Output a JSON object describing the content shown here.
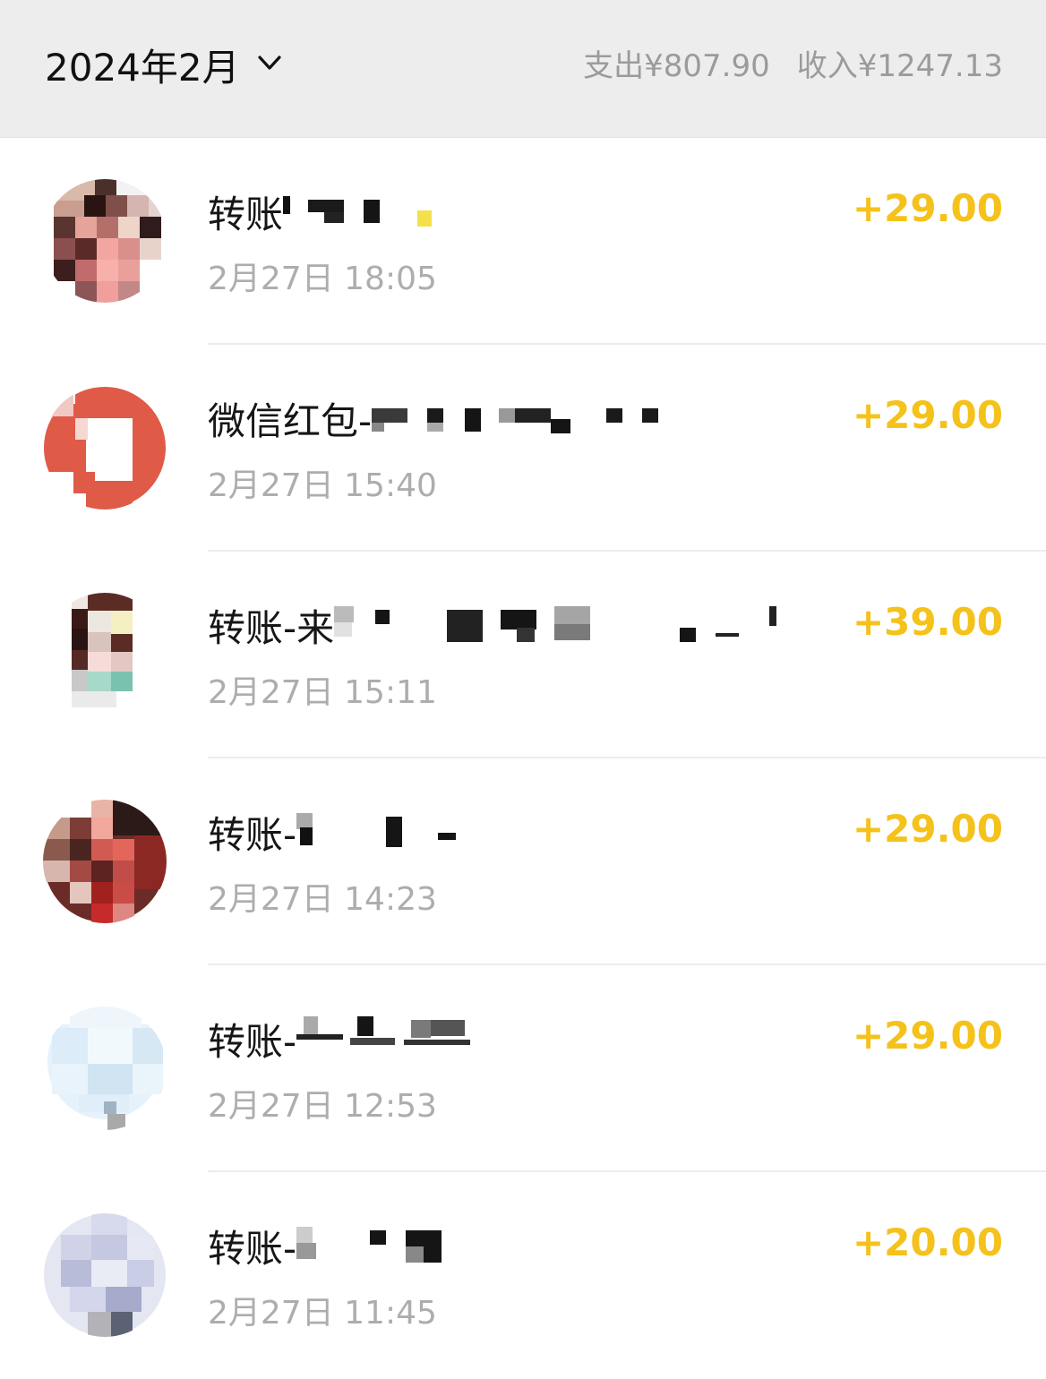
{
  "header": {
    "month": "2024年2月",
    "expense": "支出¥807.90",
    "income": "收入¥1247.13"
  },
  "colors": {
    "income_accent": "#f4c21a",
    "header_bg": "#ededed",
    "red_packet": "#e05a48"
  },
  "transactions": [
    {
      "title": "转账",
      "time": "2月27日 18:05",
      "amount": "+29.00",
      "avatar": "photo-avatar"
    },
    {
      "title": "微信红包-",
      "time": "2月27日 15:40",
      "amount": "+29.00",
      "avatar": "red-packet-avatar"
    },
    {
      "title": "转账-来",
      "time": "2月27日 15:11",
      "amount": "+39.00",
      "avatar": "photo-avatar"
    },
    {
      "title": "转账-",
      "time": "2月27日 14:23",
      "amount": "+29.00",
      "avatar": "photo-avatar"
    },
    {
      "title": "转账-",
      "time": "2月27日 12:53",
      "amount": "+29.00",
      "avatar": "photo-avatar"
    },
    {
      "title": "转账-",
      "time": "2月27日 11:45",
      "amount": "+20.00",
      "avatar": "photo-avatar"
    }
  ]
}
